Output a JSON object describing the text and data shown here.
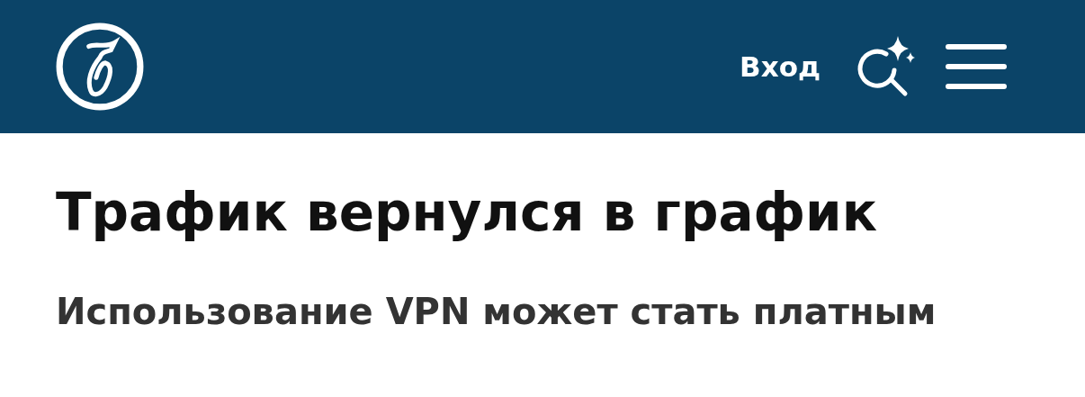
{
  "header": {
    "login": "Вход"
  },
  "article": {
    "title": "Трафик вернулся в график",
    "subtitle": "Использование VPN может стать платным"
  }
}
